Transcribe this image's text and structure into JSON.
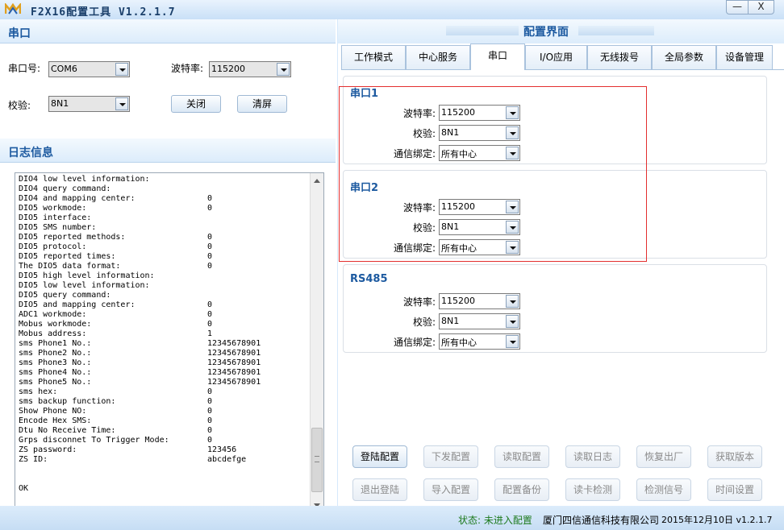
{
  "window": {
    "title": "F2X16配置工具 V1.2.1.7",
    "minimize_label": "—",
    "close_label": "X"
  },
  "serial_section": {
    "title": "串口",
    "port_label": "串口号:",
    "port_value": "COM6",
    "baud_label": "波特率:",
    "baud_value": "115200",
    "parity_label": "校验:",
    "parity_value": "8N1",
    "close_button": "关闭",
    "clear_button": "清屏"
  },
  "log_section": {
    "title": "日志信息",
    "lines": [
      {
        "k": "DIO4 low level information:",
        "v": ""
      },
      {
        "k": "DIO4 query command:",
        "v": ""
      },
      {
        "k": "DIO4 and mapping center:",
        "v": "0"
      },
      {
        "k": "DIO5 workmode:",
        "v": "0"
      },
      {
        "k": "DIO5 interface:",
        "v": ""
      },
      {
        "k": "DIO5 SMS number:",
        "v": ""
      },
      {
        "k": "DIO5 reported methods:",
        "v": "0"
      },
      {
        "k": "DIO5 protocol:",
        "v": "0"
      },
      {
        "k": "DIO5 reported times:",
        "v": "0"
      },
      {
        "k": "The DIO5 data format:",
        "v": "0"
      },
      {
        "k": "DIO5 high level information:",
        "v": ""
      },
      {
        "k": "DIO5 low level information:",
        "v": ""
      },
      {
        "k": "DIO5 query command:",
        "v": ""
      },
      {
        "k": "DIO5 and mapping center:",
        "v": "0"
      },
      {
        "k": "ADC1 workmode:",
        "v": "0"
      },
      {
        "k": "Mobus workmode:",
        "v": "0"
      },
      {
        "k": "Mobus address:",
        "v": "1"
      },
      {
        "k": "sms Phone1 No.:",
        "v": "12345678901"
      },
      {
        "k": "sms Phone2 No.:",
        "v": "12345678901"
      },
      {
        "k": "sms Phone3 No.:",
        "v": "12345678901"
      },
      {
        "k": "sms Phone4 No.:",
        "v": "12345678901"
      },
      {
        "k": "sms Phone5 No.:",
        "v": "12345678901"
      },
      {
        "k": "sms hex:",
        "v": "0"
      },
      {
        "k": "sms backup function:",
        "v": "0"
      },
      {
        "k": "Show Phone NO:",
        "v": "0"
      },
      {
        "k": "Encode Hex SMS:",
        "v": "0"
      },
      {
        "k": "Dtu No Receive Time:",
        "v": "0"
      },
      {
        "k": "Grps disconnet To Trigger Mode:",
        "v": "0"
      },
      {
        "k": "ZS password:",
        "v": "123456"
      },
      {
        "k": "ZS ID:",
        "v": "abcdefge"
      },
      {
        "k": "",
        "v": ""
      },
      {
        "k": "",
        "v": ""
      },
      {
        "k": "OK",
        "v": ""
      }
    ]
  },
  "config": {
    "title": "配置界面",
    "tabs": [
      "工作模式",
      "中心服务",
      "串口",
      "I/O应用",
      "无线拨号",
      "全局参数",
      "设备管理"
    ],
    "active_tab": 2,
    "groups": [
      {
        "title": "串口1",
        "baud_label": "波特率:",
        "baud": "115200",
        "parity_label": "校验:",
        "parity": "8N1",
        "bind_label": "通信绑定:",
        "bind": "所有中心"
      },
      {
        "title": "串口2",
        "baud_label": "波特率:",
        "baud": "115200",
        "parity_label": "校验:",
        "parity": "8N1",
        "bind_label": "通信绑定:",
        "bind": "所有中心"
      },
      {
        "title": "RS485",
        "baud_label": "波特率:",
        "baud": "115200",
        "parity_label": "校验:",
        "parity": "8N1",
        "bind_label": "通信绑定:",
        "bind": "所有中心"
      }
    ],
    "buttons_row1": [
      "登陆配置",
      "下发配置",
      "读取配置",
      "读取日志",
      "恢复出厂",
      "获取版本"
    ],
    "buttons_row2": [
      "退出登陆",
      "导入配置",
      "配置备份",
      "读卡检测",
      "检测信号",
      "时间设置"
    ],
    "enabled_buttons": [
      "登陆配置"
    ]
  },
  "status_bar": {
    "status": "状态: 未进入配置",
    "company": "厦门四信通信科技有限公司",
    "date_version": "2015年12月10日 v1.2.1.7"
  },
  "colors": {
    "accent": "#1d5aa0",
    "highlight_box": "#e32f2f",
    "status_text": "#1e7a1e",
    "disabled_text": "#8a8a8a"
  }
}
